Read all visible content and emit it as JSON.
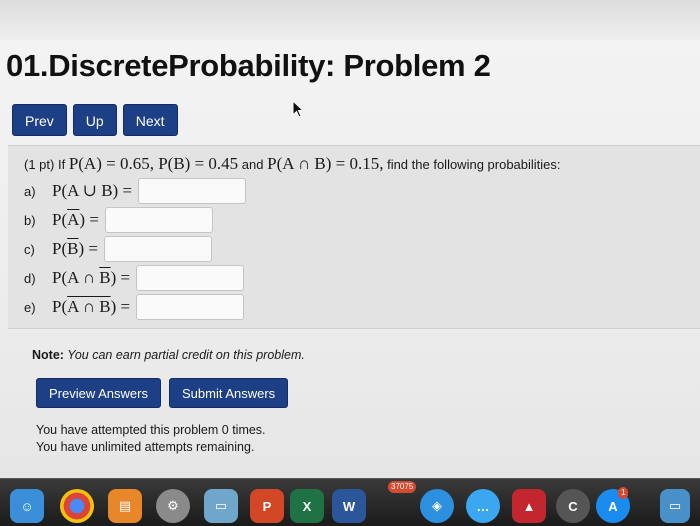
{
  "page": {
    "title": "01.DiscreteProbability: Problem 2"
  },
  "nav": {
    "prev": "Prev",
    "up": "Up",
    "next": "Next"
  },
  "problem": {
    "points": "(1 pt) If",
    "pa": "P(A) = 0.65, P(B) = 0.45",
    "and": "and",
    "pab": "P(A ∩ B) = 0.15,",
    "tail": "find the following probabilities:",
    "parts": [
      {
        "label": "a)",
        "prefix": "P(A ∪ B)",
        "bar": "",
        "suffix": "",
        "eq": "=",
        "value": ""
      },
      {
        "label": "b)",
        "prefix": "P(",
        "bar": "A",
        "suffix": ")",
        "eq": "=",
        "value": ""
      },
      {
        "label": "c)",
        "prefix": "P(",
        "bar": "B",
        "suffix": ")",
        "eq": "=",
        "value": ""
      },
      {
        "label": "d)",
        "prefix": "P(A ∩ ",
        "bar": "B",
        "suffix": ")",
        "eq": "=",
        "value": ""
      },
      {
        "label": "e)",
        "prefix": "P(",
        "bar": "A ∩ B",
        "suffix": ")",
        "eq": "=",
        "value": ""
      }
    ]
  },
  "note": {
    "label": "Note:",
    "text": "You can earn partial credit on this problem."
  },
  "actions": {
    "preview": "Preview Answers",
    "submit": "Submit Answers"
  },
  "attempts": {
    "line1": "You have attempted this problem 0 times.",
    "line2": "You have unlimited attempts remaining."
  },
  "dock": {
    "badge_mail": "37075",
    "badge_store": "1",
    "icons": [
      "finder-icon",
      "chrome-icon",
      "books-icon",
      "system-preferences-icon",
      "preview-icon",
      "powerpoint-icon",
      "excel-icon",
      "word-icon",
      "safari-icon",
      "messages-icon",
      "acrobat-icon",
      "edge-icon",
      "app-store-icon"
    ]
  },
  "colors": {
    "button": "#1d3f86",
    "problem_bg": "#e3e3e3",
    "page_bg": "#ececec"
  }
}
